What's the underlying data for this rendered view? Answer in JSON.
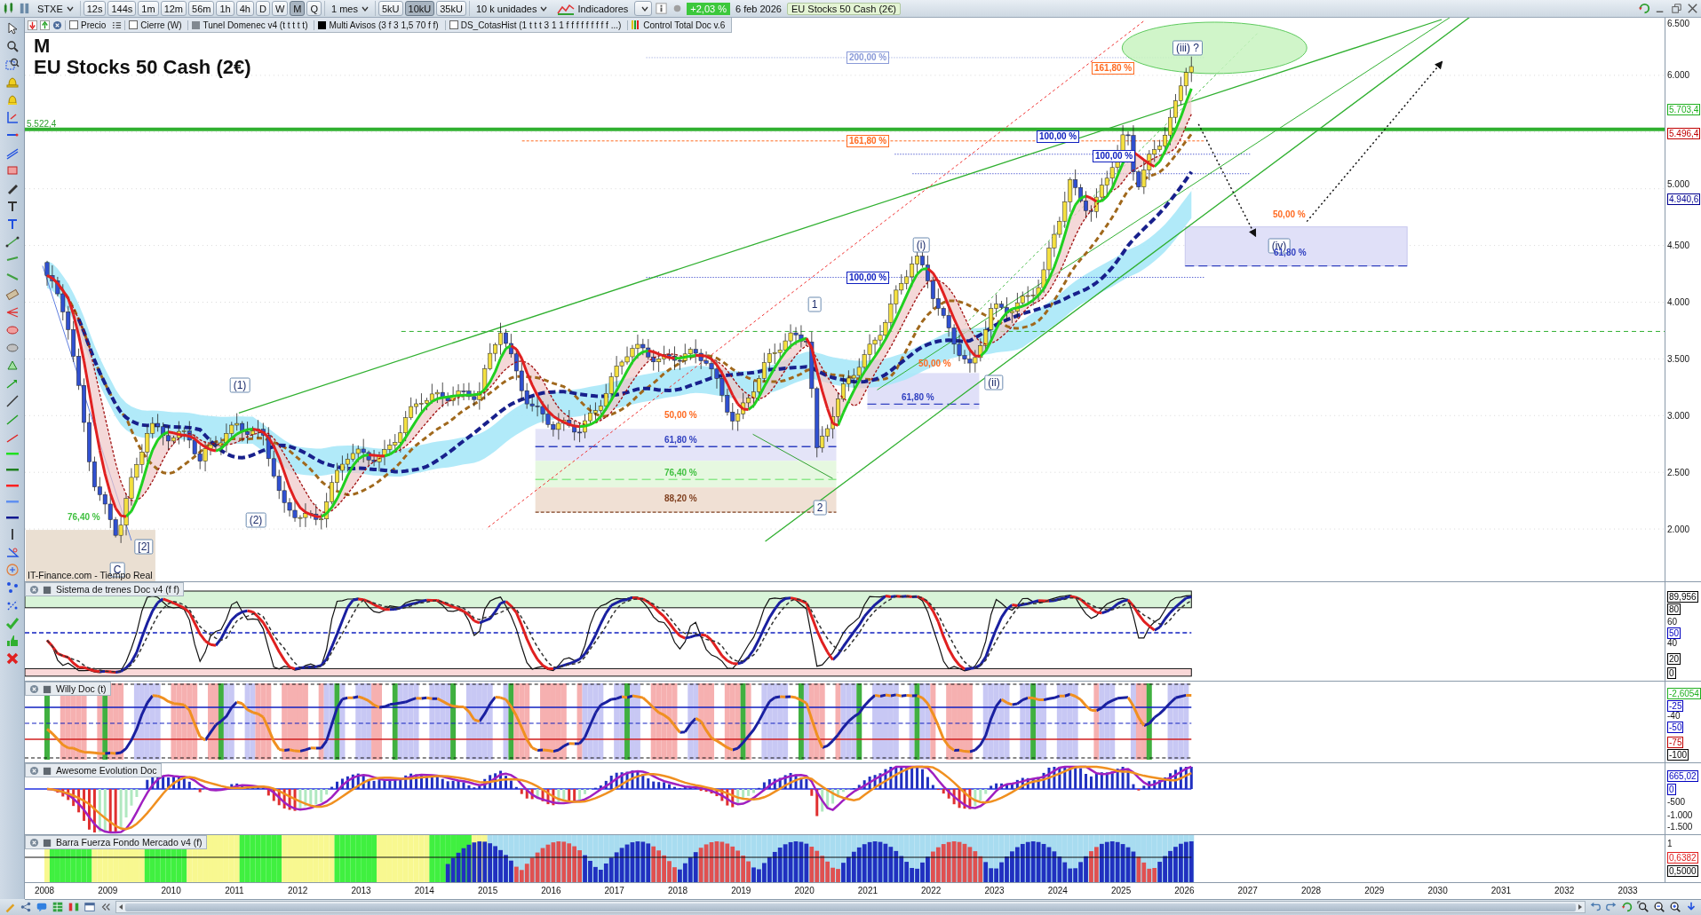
{
  "toolbar": {
    "symbol": "STXE",
    "timeframes": [
      {
        "label": "12s",
        "selected": false
      },
      {
        "label": "144s",
        "selected": false
      },
      {
        "label": "1m",
        "selected": false
      },
      {
        "label": "12m",
        "selected": false
      },
      {
        "label": "56m",
        "selected": false
      },
      {
        "label": "1h",
        "selected": false
      },
      {
        "label": "4h",
        "selected": false
      },
      {
        "label": "D",
        "selected": false
      },
      {
        "label": "W",
        "selected": false
      },
      {
        "label": "M",
        "selected": true
      },
      {
        "label": "Q",
        "selected": false
      }
    ],
    "period": "1 mes",
    "units": [
      {
        "label": "5kU",
        "selected": false
      },
      {
        "label": "10kU",
        "selected": true
      },
      {
        "label": "35kU",
        "selected": false
      }
    ],
    "unit_size": "10 k unidades",
    "indicators": "Indicadores",
    "change": "+2,03 %",
    "date": "6 feb 2026",
    "instrument": "EU Stocks 50 Cash (2€)"
  },
  "legend": [
    {
      "label": "Precio",
      "kind": "checkbox",
      "checked": false
    },
    {
      "label": "Cierre (W)",
      "kind": "checkbox",
      "checked": false
    },
    {
      "label": "Tunel Domenec v4 (t t t t t)",
      "kind": "swatch",
      "color": "#808890"
    },
    {
      "label": "Multi Avisos (3 f 3 1,5 70 f f)",
      "kind": "swatch",
      "color": "#000000"
    },
    {
      "label": "DS_CotasHist (1 t t t 3 1 1 f f f f f f f f f ...)",
      "kind": "checkbox",
      "checked": false
    },
    {
      "label": "Control Total Doc v.6",
      "kind": "bars"
    }
  ],
  "chart": {
    "timeframe_mark": "M",
    "title": "EU Stocks 50 Cash (2€)",
    "line_label": "5.522,4",
    "source": "IT-Finance.com - Tiempo Real",
    "annotations": [
      {
        "text": "200,00 %",
        "kind": "level-boxed",
        "color": "#8a9ad8"
      },
      {
        "text": "161,80 %",
        "kind": "level-boxed",
        "color": "#ff6a20"
      },
      {
        "text": "161,80 %",
        "kind": "level-boxed",
        "color": "#ff6a20"
      },
      {
        "text": "100,00 %",
        "kind": "level-boxed",
        "color": "#1020c0"
      },
      {
        "text": "100,00 %",
        "kind": "level-boxed",
        "color": "#1020c0"
      },
      {
        "text": "100,00 %",
        "kind": "level-boxed",
        "color": "#1020c0"
      },
      {
        "text": "(iii) ?",
        "kind": "wave"
      },
      {
        "text": "50,00 %",
        "kind": "level",
        "color": "#ff6a20"
      },
      {
        "text": "(iv)",
        "kind": "wave"
      },
      {
        "text": "61,80 %",
        "kind": "level",
        "color": "#3040c0"
      },
      {
        "text": "(i)",
        "kind": "wave"
      },
      {
        "text": "1",
        "kind": "wave"
      },
      {
        "text": "50,00 %",
        "kind": "level",
        "color": "#ff6a20"
      },
      {
        "text": "(ii)",
        "kind": "wave"
      },
      {
        "text": "61,80 %",
        "kind": "level",
        "color": "#3040c0"
      },
      {
        "text": "(1)",
        "kind": "wave"
      },
      {
        "text": "50,00 %",
        "kind": "level",
        "color": "#ff6a20"
      },
      {
        "text": "61,80 %",
        "kind": "level",
        "color": "#3040c0"
      },
      {
        "text": "76,40 %",
        "kind": "level",
        "color": "#40c040"
      },
      {
        "text": "88,20 %",
        "kind": "level",
        "color": "#804020"
      },
      {
        "text": "2",
        "kind": "wave"
      },
      {
        "text": "(2)",
        "kind": "wave"
      },
      {
        "text": "[2]",
        "kind": "wave"
      },
      {
        "text": "76,40 %",
        "kind": "level",
        "color": "#40c040"
      },
      {
        "text": "C",
        "kind": "wave"
      }
    ],
    "axis_labels": [
      {
        "text": "6.500",
        "kind": "tick"
      },
      {
        "text": "6.000",
        "kind": "tick"
      },
      {
        "text": "5.703,4",
        "kind": "tag",
        "color": "#20b020"
      },
      {
        "text": "5.496,4",
        "kind": "tag",
        "color": "#c00000"
      },
      {
        "text": "5.000",
        "kind": "tick"
      },
      {
        "text": "4.940,6",
        "kind": "tag",
        "color": "#000090"
      },
      {
        "text": "4.500",
        "kind": "tick"
      },
      {
        "text": "4.000",
        "kind": "tick"
      },
      {
        "text": "3.500",
        "kind": "tick"
      },
      {
        "text": "3.000",
        "kind": "tick"
      },
      {
        "text": "2.500",
        "kind": "tick"
      },
      {
        "text": "2.000",
        "kind": "tick"
      }
    ]
  },
  "panels": [
    {
      "title": "Sistema de trenes Doc v4 (f f)",
      "axis_labels": [
        {
          "text": "89,956",
          "kind": "tag",
          "color": "#000000"
        },
        {
          "text": "80",
          "kind": "tag",
          "color": "#000000"
        },
        {
          "text": "60",
          "kind": "tick"
        },
        {
          "text": "50",
          "kind": "tag",
          "color": "#0000c0"
        },
        {
          "text": "40",
          "kind": "tick"
        },
        {
          "text": "20",
          "kind": "tag",
          "color": "#000000"
        },
        {
          "text": "0",
          "kind": "tag",
          "color": "#000000"
        }
      ]
    },
    {
      "title": "Willy Doc (t)",
      "axis_labels": [
        {
          "text": "-2,6054",
          "kind": "tag",
          "color": "#20b020"
        },
        {
          "text": "-25",
          "kind": "tag",
          "color": "#0000c0"
        },
        {
          "text": "-40",
          "kind": "tick"
        },
        {
          "text": "-50",
          "kind": "tag",
          "color": "#0000c0"
        },
        {
          "text": "-75",
          "kind": "tag",
          "color": "#c00000"
        },
        {
          "text": "-100",
          "kind": "tag",
          "color": "#000000"
        }
      ]
    },
    {
      "title": "Awesome Evolution Doc",
      "axis_labels": [
        {
          "text": "665,02",
          "kind": "tag",
          "color": "#0000c0"
        },
        {
          "text": "0",
          "kind": "tag",
          "color": "#0000c0"
        },
        {
          "text": "-500",
          "kind": "tick"
        },
        {
          "text": "-1.000",
          "kind": "tick"
        },
        {
          "text": "-1.500",
          "kind": "tick"
        }
      ]
    },
    {
      "title": "Barra Fuerza Fondo Mercado v4 (f)",
      "axis_labels": [
        {
          "text": "1",
          "kind": "tick"
        },
        {
          "text": "0,6382",
          "kind": "tag",
          "color": "#e02020"
        },
        {
          "text": "0,5000",
          "kind": "tag",
          "color": "#000000"
        }
      ]
    }
  ],
  "years": [
    "2008",
    "2009",
    "2010",
    "2011",
    "2012",
    "2013",
    "2014",
    "2015",
    "2016",
    "2017",
    "2018",
    "2019",
    "2020",
    "2021",
    "2022",
    "2023",
    "2024",
    "2025",
    "2026",
    "2027",
    "2028",
    "2029",
    "2030",
    "2031",
    "2032",
    "2033"
  ],
  "line_swatches": [
    {
      "color": "#20e020"
    },
    {
      "color": "#208020"
    },
    {
      "color": "#ff2020"
    },
    {
      "color": "#6090f0"
    },
    {
      "color": "#101890"
    }
  ]
}
